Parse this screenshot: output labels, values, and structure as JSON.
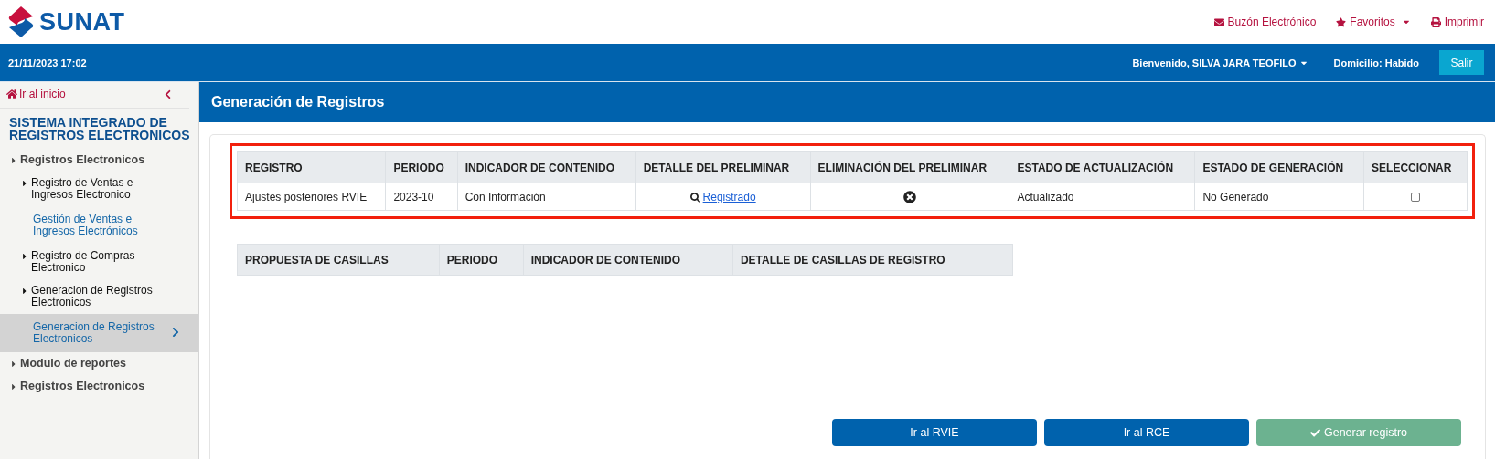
{
  "header": {
    "logo_text": "SUNAT",
    "links": [
      {
        "kind": "mail",
        "label": "Buzón Electrónico",
        "dropdown": false
      },
      {
        "kind": "star",
        "label": "Favoritos",
        "dropdown": true
      },
      {
        "kind": "print",
        "label": "Imprimir",
        "dropdown": false
      }
    ]
  },
  "top_bar": {
    "datetime": "21/11/2023 17:02",
    "user": "Bienvenido, SILVA JARA TEOFILO",
    "domicilio": "Domicilio: Habido",
    "logout": "Salir"
  },
  "sidebar": {
    "home": "Ir al inicio",
    "title": "SISTEMA INTEGRADO DE REGISTROS ELECTRONICOS",
    "items": [
      {
        "label": "Registros Electronicos",
        "children": [
          {
            "label": "Registro de Ventas e Ingresos Electronico",
            "children": [
              {
                "label": "Gestión de Ventas e Ingresos Electrónicos",
                "selected": false
              }
            ]
          },
          {
            "label": "Registro de Compras Electronico"
          },
          {
            "label": "Generacion de Registros Electronicos",
            "children": [
              {
                "label": "Generacion de Registros Electronicos",
                "selected": true
              }
            ]
          }
        ]
      },
      {
        "label": "Modulo de reportes"
      },
      {
        "label": "Registros Electronicos"
      }
    ]
  },
  "page_title": "Generación de Registros",
  "registros_table": {
    "highlighted": true,
    "columns": [
      "REGISTRO",
      "PERIODO",
      "INDICADOR DE CONTENIDO",
      "DETALLE DEL PRELIMINAR",
      "ELIMINACIÓN DEL PRELIMINAR",
      "ESTADO DE ACTUALIZACIÓN",
      "ESTADO DE GENERACIÓN",
      "SELECCIONAR"
    ],
    "rows": [
      {
        "registro": "Ajustes posteriores RVIE",
        "periodo": "2023-10",
        "indicador": "Con Información",
        "detalle": "Registrado",
        "estado_actualizacion": "Actualizado",
        "estado_generacion": "No Generado",
        "checked": false
      }
    ]
  },
  "casillas_table": {
    "columns": [
      "PROPUESTA DE CASILLAS",
      "PERIODO",
      "INDICADOR DE CONTENIDO",
      "DETALLE DE CASILLAS DE REGISTRO"
    ]
  },
  "buttons": [
    {
      "kind": "plain",
      "label": "Ir al RVIE",
      "disabled": false
    },
    {
      "kind": "plain",
      "label": "Ir al RCE",
      "disabled": false
    },
    {
      "kind": "check",
      "label": "Generar registro",
      "disabled": true
    }
  ]
}
